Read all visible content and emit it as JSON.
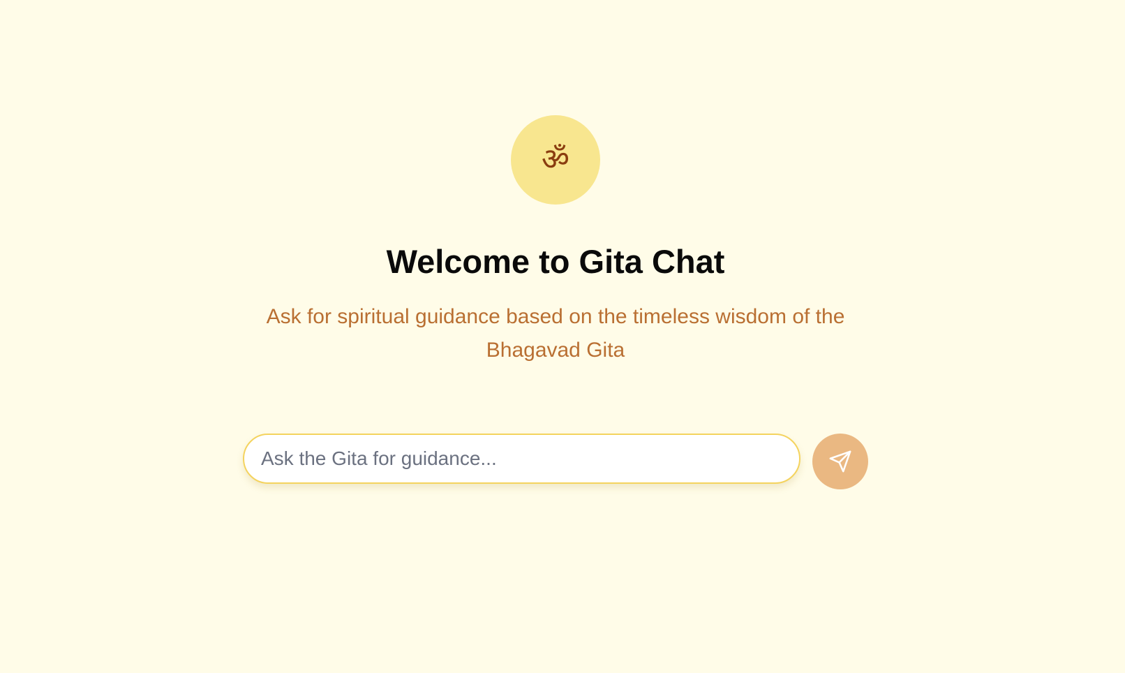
{
  "logo": {
    "glyph": "ॐ",
    "icon": "om-icon",
    "background_color": "#f8e68f",
    "glyph_color": "#8a3d0f"
  },
  "header": {
    "title": "Welcome to Gita Chat",
    "subtitle": "Ask for spiritual guidance based on the timeless wisdom of the Bhagavad Gita"
  },
  "chat": {
    "input_value": "",
    "input_placeholder": "Ask the Gita for guidance...",
    "send_icon": "send-icon",
    "send_button_color": "#eab882"
  },
  "colors": {
    "background": "#fffce8",
    "subtitle": "#b96f32",
    "input_border": "#f4d35e"
  }
}
